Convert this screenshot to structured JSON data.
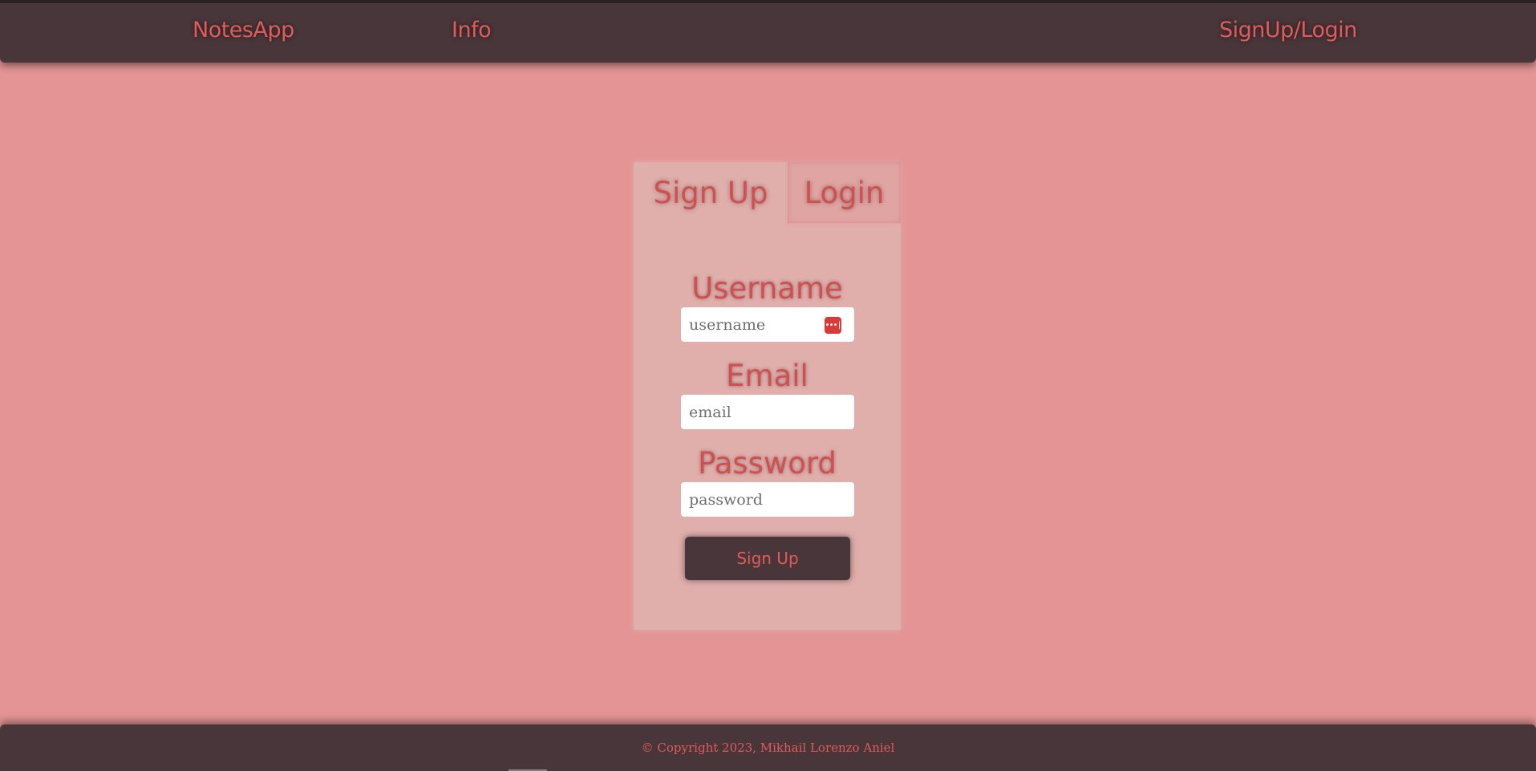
{
  "nav": {
    "brand": "NotesApp",
    "info": "Info",
    "auth": "SignUp/Login"
  },
  "auth_panel": {
    "tabs": [
      {
        "label": "Sign Up",
        "active": true
      },
      {
        "label": "Login",
        "active": false
      }
    ],
    "fields": {
      "username": {
        "label": "Username",
        "placeholder": "username",
        "value": ""
      },
      "email": {
        "label": "Email",
        "placeholder": "email",
        "value": ""
      },
      "password": {
        "label": "Password",
        "placeholder": "password",
        "value": ""
      }
    },
    "password_manager_icon": "password-manager-icon",
    "submit_label": "Sign Up"
  },
  "footer": {
    "copyright": "© Copyright 2023, Mikhail Lorenzo Aniel"
  },
  "colors": {
    "background": "#e49494",
    "bar": "#48363a",
    "panel": "#e0aeab",
    "accent": "#d24f50"
  }
}
